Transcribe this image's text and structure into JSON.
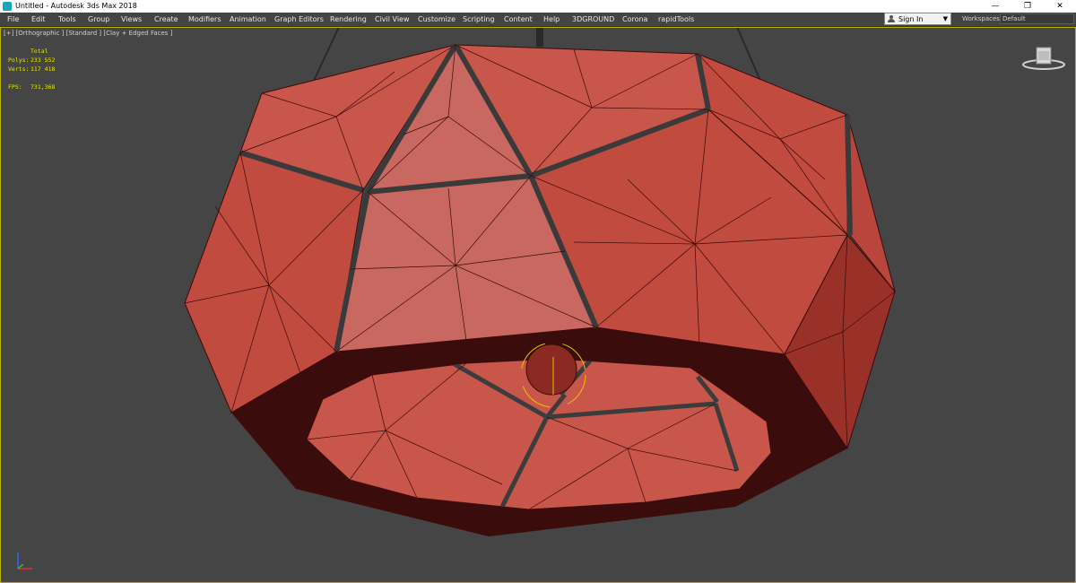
{
  "window": {
    "title": "Untitled - Autodesk 3ds Max 2018",
    "minimize_glyph": "—",
    "restore_glyph": "❐",
    "close_glyph": "✕"
  },
  "menu": {
    "items": [
      "File",
      "Edit",
      "Tools",
      "Group",
      "Views",
      "Create",
      "Modifiers",
      "Animation",
      "Graph Editors",
      "Rendering",
      "Civil View",
      "Customize",
      "Scripting",
      "Content",
      "Help",
      "3DGROUND",
      "Corona",
      "rapidTools"
    ]
  },
  "account": {
    "signin_label": "Sign In",
    "workspaces_label": "Workspaces:",
    "workspace_value": "Default"
  },
  "viewport": {
    "label": "[+] [Orthographic ] [Standard ] [Clay + Edged Faces ]",
    "stats": {
      "header": "Total",
      "polys_label": "Polys:",
      "polys_value": "233 552",
      "verts_label": "Verts:",
      "verts_value": "117 418",
      "fps_label": "FPS:",
      "fps_value": "731,368"
    }
  },
  "colors": {
    "viewport_bg": "#454545",
    "model_face": "#c8564a",
    "model_dark": "#3a0c0c",
    "stats_text": "#e8e800"
  },
  "icons": {
    "app": "3ds-max-icon",
    "user": "user-icon",
    "viewcube": "viewcube-icon",
    "axis": "axis-tripod-icon"
  }
}
